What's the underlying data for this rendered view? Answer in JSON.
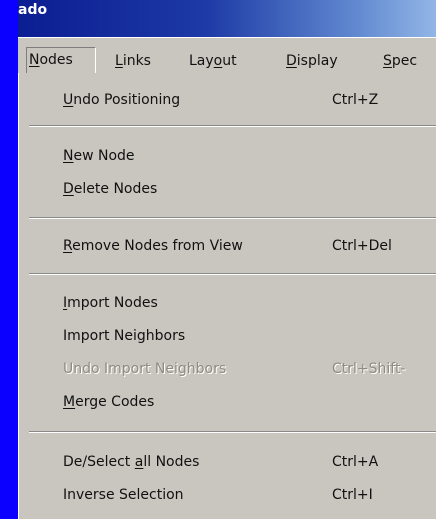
{
  "window": {
    "title": "ado"
  },
  "menubar": {
    "items": [
      {
        "label_prefix": "",
        "label_access": "N",
        "label_rest": "odes"
      },
      {
        "label_prefix": "",
        "label_access": "L",
        "label_rest": "inks"
      },
      {
        "label_prefix": "Lay",
        "label_access": "o",
        "label_rest": "ut"
      },
      {
        "label_prefix": "",
        "label_access": "D",
        "label_rest": "isplay"
      },
      {
        "label_prefix": "",
        "label_access": "S",
        "label_rest": "pec"
      }
    ]
  },
  "dropdown": {
    "items": [
      {
        "prefix": "",
        "access": "U",
        "rest": "ndo Positioning",
        "shortcut": "Ctrl+Z"
      },
      {
        "prefix": "",
        "access": "N",
        "rest": "ew Node",
        "shortcut": ""
      },
      {
        "prefix": "",
        "access": "D",
        "rest": "elete Nodes",
        "shortcut": ""
      },
      {
        "prefix": "",
        "access": "R",
        "rest": "emove Nodes from View",
        "shortcut": "Ctrl+Del"
      },
      {
        "prefix": "",
        "access": "I",
        "rest": "mport Nodes",
        "shortcut": ""
      },
      {
        "prefix": "",
        "access": "",
        "rest": "Import Neighbors",
        "shortcut": ""
      },
      {
        "prefix": "",
        "access": "",
        "rest": "Undo Import Neighbors",
        "shortcut": "Ctrl+Shift-"
      },
      {
        "prefix": "",
        "access": "M",
        "rest": "erge Codes",
        "shortcut": ""
      },
      {
        "prefix": "De/Select ",
        "access": "a",
        "rest": "ll Nodes",
        "shortcut": "Ctrl+A"
      },
      {
        "prefix": "",
        "access": "",
        "rest": "Inverse Selection",
        "shortcut": "Ctrl+I"
      }
    ]
  },
  "colors": {
    "desktop_blue": "#0b00ff",
    "menu_face": "#c9c6bf",
    "disabled_text": "#8f8b82",
    "title_red_mark": "#ff2a2a"
  }
}
